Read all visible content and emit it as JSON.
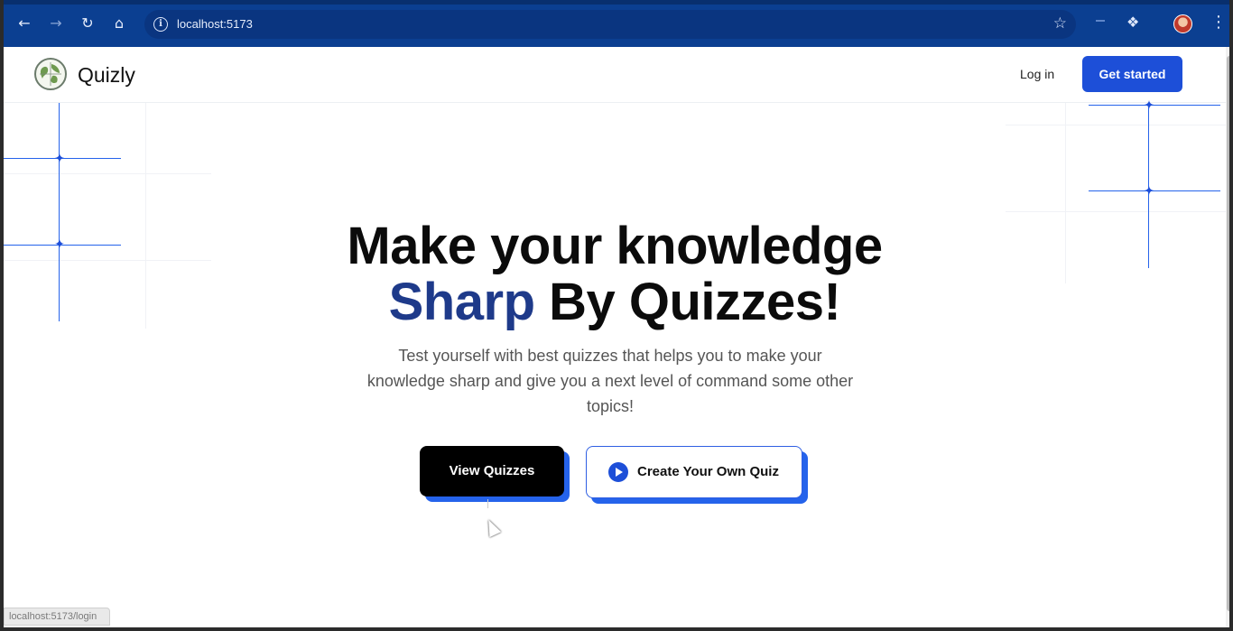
{
  "browser": {
    "url": "localhost:5173"
  },
  "header": {
    "brand": "Quizly",
    "login_label": "Log in",
    "get_started_label": "Get started"
  },
  "hero": {
    "title_line1": "Make your knowledge",
    "title_accent": "Sharp",
    "title_rest": " By Quizzes!",
    "subtitle": "Test yourself with best quizzes that helps you to make your knowledge sharp and give you a next level of command some other topics!",
    "view_quizzes_label": "View Quizzes",
    "create_quiz_label": "Create Your Own Quiz"
  },
  "status_bar": {
    "link_preview": "localhost:5173/login"
  },
  "colors": {
    "chrome": "#0b3f91",
    "accent_blue": "#1d4fd8",
    "title_accent": "#1e3a8a"
  }
}
